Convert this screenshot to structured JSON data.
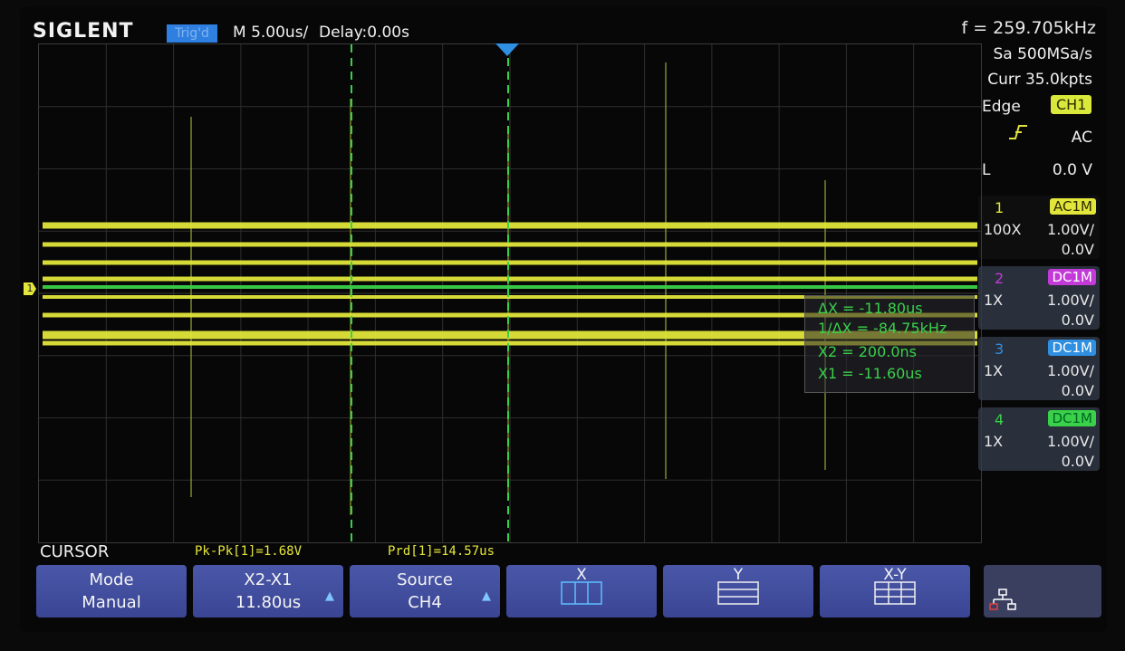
{
  "header": {
    "brand": "SIGLENT",
    "trigger_status": "Trig'd",
    "timebase": "M 5.00us/",
    "delay": "Delay:0.00s"
  },
  "acquisition": {
    "frequency": "f = 259.705kHz",
    "sample_rate": "Sa 500MSa/s",
    "memory": "Curr 35.0kpts"
  },
  "trigger": {
    "type": "Edge",
    "source": "CH1",
    "slope_icon": "rising-edge-icon",
    "coupling": "AC",
    "level_label": "L",
    "level_value": "0.0 V"
  },
  "channels": [
    {
      "num": "1",
      "coupling": "AC1M",
      "probe": "100X",
      "scale": "1.00V/",
      "offset": "0.0V",
      "color": "#e2e63a"
    },
    {
      "num": "2",
      "coupling": "DC1M",
      "probe": "1X",
      "scale": "1.00V/",
      "offset": "0.0V",
      "color": "#c23ad8"
    },
    {
      "num": "3",
      "coupling": "DC1M",
      "probe": "1X",
      "scale": "1.00V/",
      "offset": "0.0V",
      "color": "#2f8fe0"
    },
    {
      "num": "4",
      "coupling": "DC1M",
      "probe": "1X",
      "scale": "1.00V/",
      "offset": "0.0V",
      "color": "#3ad04a"
    }
  ],
  "ch1_marker": "1",
  "cursor_readout": {
    "delta_x": "ΔX = -11.80us",
    "one_over_delta_x": "1/ΔX = -84.75kHz",
    "x2": "X2 = 200.0ns",
    "x1": "X1 = -11.60us"
  },
  "bottom": {
    "menu_title": "CURSOR",
    "measure1": "Pk-Pk[1]=1.68V",
    "measure2": "Prd[1]=14.57us"
  },
  "softkeys": [
    {
      "line1": "Mode",
      "line2": "Manual"
    },
    {
      "line1": "X2-X1",
      "line2": "11.80us",
      "icon": "up-arrow-icon"
    },
    {
      "line1": "Source",
      "line2": "CH4",
      "icon": "up-arrow-icon"
    },
    {
      "line1": "X",
      "icon": "x-cursor-icon"
    },
    {
      "line1": "Y",
      "icon": "y-cursor-icon"
    },
    {
      "line1": "X-Y",
      "icon": "xy-cursor-icon"
    },
    {
      "icon": "network-icon"
    }
  ],
  "colors": {
    "trace": "#e2e63a",
    "cursor": "#3ad04a",
    "trigger_marker": "#2f8fe0",
    "softkey_bg": "#3f4b9c"
  }
}
